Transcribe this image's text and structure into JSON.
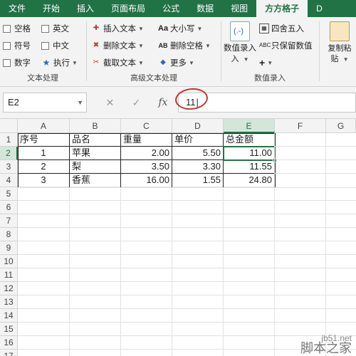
{
  "ribbon_tabs": [
    "文件",
    "开始",
    "插入",
    "页面布局",
    "公式",
    "数据",
    "视图",
    "方方格子",
    "D"
  ],
  "active_tab_index": 7,
  "groups": {
    "text_processing": {
      "label": "文本处理",
      "checkboxes": [
        "空格",
        "英文",
        "符号",
        "中文",
        "数字"
      ],
      "execute": "执行"
    },
    "advanced_text": {
      "label": "高级文本处理",
      "col1": [
        "插入文本",
        "删除文本",
        "截取文本"
      ],
      "col2": [
        "大小写",
        "删除空格",
        "更多"
      ]
    },
    "numeric_entry": {
      "label": "数值录入",
      "big_button": "数值录入",
      "items": [
        "四舍五入",
        "只保留数值",
        "+"
      ]
    },
    "copy_paste": {
      "label": "复制粘贴"
    }
  },
  "formula_bar": {
    "name_box": "E2",
    "cancel_icon": "✕",
    "confirm_icon": "✓",
    "fx_label": "fx",
    "value": "11"
  },
  "columns": [
    "A",
    "B",
    "C",
    "D",
    "E",
    "F",
    "G"
  ],
  "rows": [
    "1",
    "2",
    "3",
    "4",
    "5",
    "6",
    "7",
    "8",
    "9",
    "10",
    "11",
    "12",
    "13",
    "14",
    "15",
    "16",
    "17"
  ],
  "table": {
    "headers": [
      "序号",
      "品名",
      "重量",
      "单价",
      "总金额"
    ],
    "data": [
      [
        "1",
        "苹果",
        "2.00",
        "5.50",
        "11.00"
      ],
      [
        "2",
        "梨",
        "3.50",
        "3.30",
        "11.55"
      ],
      [
        "3",
        "香蕉",
        "16.00",
        "1.55",
        "24.80"
      ]
    ]
  },
  "selected_cell": "E2",
  "watermark": {
    "line1": "jb51.net",
    "line2": "脚本之家"
  },
  "colors": {
    "accent": "#217346",
    "annotation": "#c0392b"
  }
}
